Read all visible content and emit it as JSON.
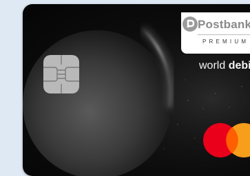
{
  "card": {
    "bank_name": "Postbank",
    "tier": "PREMIUM",
    "product_light": "world ",
    "product_bold": "debi",
    "network_logo": "mastercard-logo-icon",
    "chip_icon": "emv-chip-icon",
    "artwork": "eclipse-planet-artwork"
  },
  "colors": {
    "card_background": "#0b0b0b",
    "page_background": "#dfe9f4",
    "mastercard_red": "#eb001b",
    "mastercard_orange": "#f79e1b",
    "mastercard_overlap": "#ff5f00"
  }
}
